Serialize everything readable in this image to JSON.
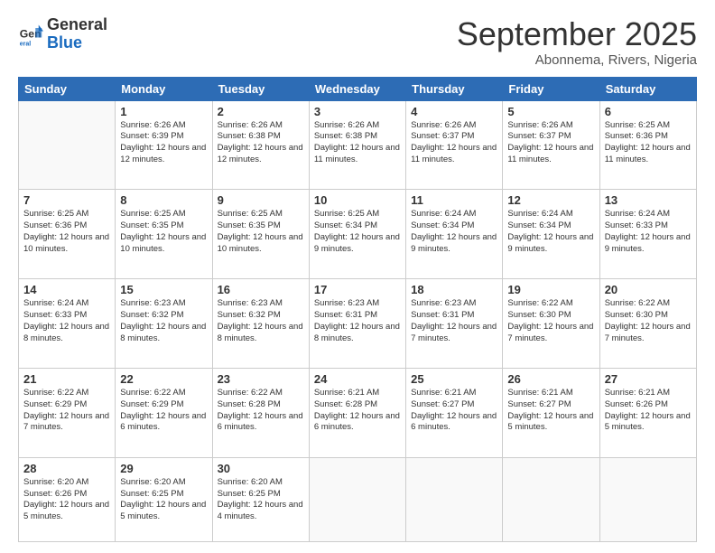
{
  "logo": {
    "general": "General",
    "blue": "Blue"
  },
  "header": {
    "month": "September 2025",
    "location": "Abonnema, Rivers, Nigeria"
  },
  "days": [
    "Sunday",
    "Monday",
    "Tuesday",
    "Wednesday",
    "Thursday",
    "Friday",
    "Saturday"
  ],
  "weeks": [
    [
      {
        "num": "",
        "info": ""
      },
      {
        "num": "1",
        "info": "Sunrise: 6:26 AM\nSunset: 6:39 PM\nDaylight: 12 hours\nand 12 minutes."
      },
      {
        "num": "2",
        "info": "Sunrise: 6:26 AM\nSunset: 6:38 PM\nDaylight: 12 hours\nand 12 minutes."
      },
      {
        "num": "3",
        "info": "Sunrise: 6:26 AM\nSunset: 6:38 PM\nDaylight: 12 hours\nand 11 minutes."
      },
      {
        "num": "4",
        "info": "Sunrise: 6:26 AM\nSunset: 6:37 PM\nDaylight: 12 hours\nand 11 minutes."
      },
      {
        "num": "5",
        "info": "Sunrise: 6:26 AM\nSunset: 6:37 PM\nDaylight: 12 hours\nand 11 minutes."
      },
      {
        "num": "6",
        "info": "Sunrise: 6:25 AM\nSunset: 6:36 PM\nDaylight: 12 hours\nand 11 minutes."
      }
    ],
    [
      {
        "num": "7",
        "info": "Sunrise: 6:25 AM\nSunset: 6:36 PM\nDaylight: 12 hours\nand 10 minutes."
      },
      {
        "num": "8",
        "info": "Sunrise: 6:25 AM\nSunset: 6:35 PM\nDaylight: 12 hours\nand 10 minutes."
      },
      {
        "num": "9",
        "info": "Sunrise: 6:25 AM\nSunset: 6:35 PM\nDaylight: 12 hours\nand 10 minutes."
      },
      {
        "num": "10",
        "info": "Sunrise: 6:25 AM\nSunset: 6:34 PM\nDaylight: 12 hours\nand 9 minutes."
      },
      {
        "num": "11",
        "info": "Sunrise: 6:24 AM\nSunset: 6:34 PM\nDaylight: 12 hours\nand 9 minutes."
      },
      {
        "num": "12",
        "info": "Sunrise: 6:24 AM\nSunset: 6:34 PM\nDaylight: 12 hours\nand 9 minutes."
      },
      {
        "num": "13",
        "info": "Sunrise: 6:24 AM\nSunset: 6:33 PM\nDaylight: 12 hours\nand 9 minutes."
      }
    ],
    [
      {
        "num": "14",
        "info": "Sunrise: 6:24 AM\nSunset: 6:33 PM\nDaylight: 12 hours\nand 8 minutes."
      },
      {
        "num": "15",
        "info": "Sunrise: 6:23 AM\nSunset: 6:32 PM\nDaylight: 12 hours\nand 8 minutes."
      },
      {
        "num": "16",
        "info": "Sunrise: 6:23 AM\nSunset: 6:32 PM\nDaylight: 12 hours\nand 8 minutes."
      },
      {
        "num": "17",
        "info": "Sunrise: 6:23 AM\nSunset: 6:31 PM\nDaylight: 12 hours\nand 8 minutes."
      },
      {
        "num": "18",
        "info": "Sunrise: 6:23 AM\nSunset: 6:31 PM\nDaylight: 12 hours\nand 7 minutes."
      },
      {
        "num": "19",
        "info": "Sunrise: 6:22 AM\nSunset: 6:30 PM\nDaylight: 12 hours\nand 7 minutes."
      },
      {
        "num": "20",
        "info": "Sunrise: 6:22 AM\nSunset: 6:30 PM\nDaylight: 12 hours\nand 7 minutes."
      }
    ],
    [
      {
        "num": "21",
        "info": "Sunrise: 6:22 AM\nSunset: 6:29 PM\nDaylight: 12 hours\nand 7 minutes."
      },
      {
        "num": "22",
        "info": "Sunrise: 6:22 AM\nSunset: 6:29 PM\nDaylight: 12 hours\nand 6 minutes."
      },
      {
        "num": "23",
        "info": "Sunrise: 6:22 AM\nSunset: 6:28 PM\nDaylight: 12 hours\nand 6 minutes."
      },
      {
        "num": "24",
        "info": "Sunrise: 6:21 AM\nSunset: 6:28 PM\nDaylight: 12 hours\nand 6 minutes."
      },
      {
        "num": "25",
        "info": "Sunrise: 6:21 AM\nSunset: 6:27 PM\nDaylight: 12 hours\nand 6 minutes."
      },
      {
        "num": "26",
        "info": "Sunrise: 6:21 AM\nSunset: 6:27 PM\nDaylight: 12 hours\nand 5 minutes."
      },
      {
        "num": "27",
        "info": "Sunrise: 6:21 AM\nSunset: 6:26 PM\nDaylight: 12 hours\nand 5 minutes."
      }
    ],
    [
      {
        "num": "28",
        "info": "Sunrise: 6:20 AM\nSunset: 6:26 PM\nDaylight: 12 hours\nand 5 minutes."
      },
      {
        "num": "29",
        "info": "Sunrise: 6:20 AM\nSunset: 6:25 PM\nDaylight: 12 hours\nand 5 minutes."
      },
      {
        "num": "30",
        "info": "Sunrise: 6:20 AM\nSunset: 6:25 PM\nDaylight: 12 hours\nand 4 minutes."
      },
      {
        "num": "",
        "info": ""
      },
      {
        "num": "",
        "info": ""
      },
      {
        "num": "",
        "info": ""
      },
      {
        "num": "",
        "info": ""
      }
    ]
  ]
}
